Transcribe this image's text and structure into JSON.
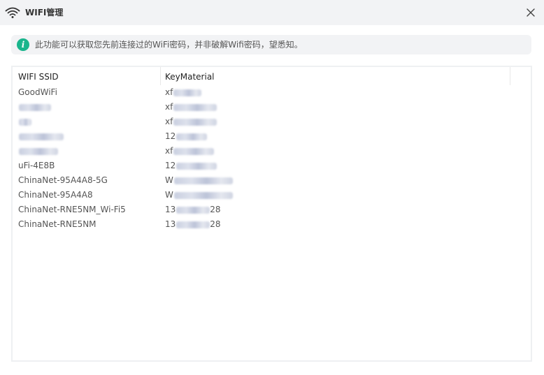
{
  "window": {
    "title": "WIFI管理"
  },
  "notice": {
    "text": "此功能可以获取您先前连接过的WiFi密码，并非破解Wifi密码，望悉知。"
  },
  "table": {
    "columns": [
      "WIFI SSID",
      "KeyMaterial"
    ],
    "rows": [
      {
        "ssid": "GoodWiFi",
        "ssid_blur": 0,
        "key": "xf",
        "key_blur": 40
      },
      {
        "ssid": "",
        "ssid_blur": 46,
        "key": "xf",
        "key_blur": 62
      },
      {
        "ssid": "",
        "ssid_blur": 18,
        "key": "xf",
        "key_blur": 62
      },
      {
        "ssid": "",
        "ssid_blur": 64,
        "key": "12",
        "key_blur": 44
      },
      {
        "ssid": "",
        "ssid_blur": 56,
        "key": "xf",
        "key_blur": 58
      },
      {
        "ssid": "uFi-4E8B",
        "ssid_blur": 0,
        "key": "12",
        "key_blur": 58
      },
      {
        "ssid": "ChinaNet-95A4A8-5G",
        "ssid_blur": 0,
        "key": "W",
        "key_blur": 84
      },
      {
        "ssid": "ChinaNet-95A4A8",
        "ssid_blur": 0,
        "key": "W",
        "key_blur": 84
      },
      {
        "ssid": "ChinaNet-RNE5NM_Wi-Fi5",
        "ssid_blur": 0,
        "key": "13",
        "key_blur": 48,
        "key_suffix": "28"
      },
      {
        "ssid": "ChinaNet-RNE5NM",
        "ssid_blur": 0,
        "key": "13",
        "key_blur": 48,
        "key_suffix": "28"
      }
    ]
  },
  "colors": {
    "accent": "#1ab58c",
    "titlebar_bg": "#f2f3f5",
    "notice_bg": "#f2f3f5"
  },
  "icons": {
    "title": "wifi-icon",
    "close": "close-icon",
    "info": "info-icon"
  }
}
